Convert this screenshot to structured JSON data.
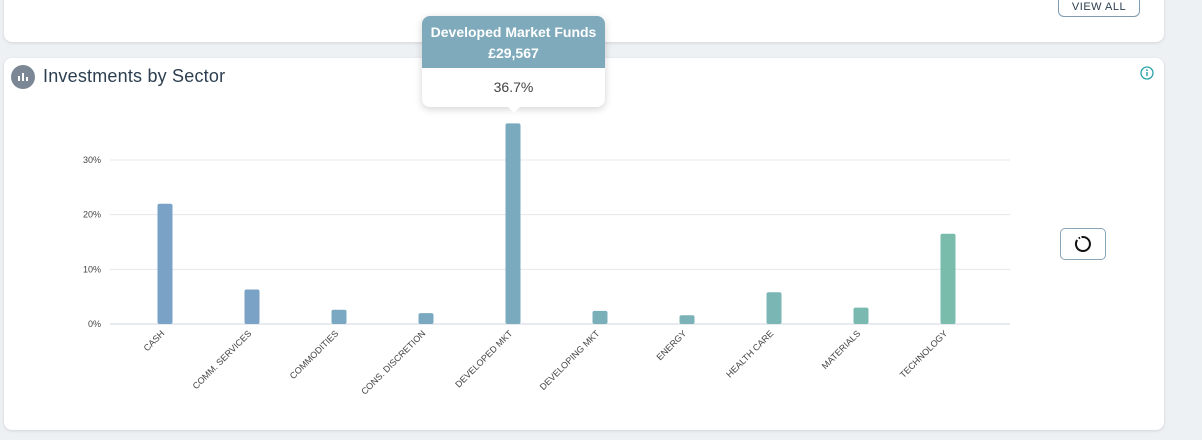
{
  "top_card": {
    "view_all_label": "VIEW ALL"
  },
  "card": {
    "title": "Investments by Sector"
  },
  "tooltip": {
    "title": "Developed Market Funds",
    "amount": "£29,567",
    "percent": "36.7%"
  },
  "chart_data": {
    "type": "bar",
    "categories": [
      "CASH",
      "COMM. SERVICES",
      "COMMODITIES",
      "CONS. DISCRETION",
      "DEVELOPED MKT",
      "DEVELOPING MKT",
      "ENERGY",
      "HEALTH CARE",
      "MATERIALS",
      "TECHNOLOGY"
    ],
    "values": [
      22.0,
      6.3,
      2.6,
      2.0,
      36.7,
      2.4,
      1.6,
      5.8,
      3.0,
      16.5
    ],
    "ytick_labels": [
      "0%",
      "10%",
      "20%",
      "30%"
    ],
    "yticks": [
      0,
      10,
      20,
      30
    ],
    "ylim": [
      0,
      30
    ],
    "colors": [
      "#7aa2c6",
      "#7aa2c6",
      "#7aa7c2",
      "#7aa8c0",
      "#7aaabe",
      "#7aafba",
      "#7ab2b7",
      "#7ab6b3",
      "#7ab9b0",
      "#7abcac"
    ],
    "grid": true
  }
}
